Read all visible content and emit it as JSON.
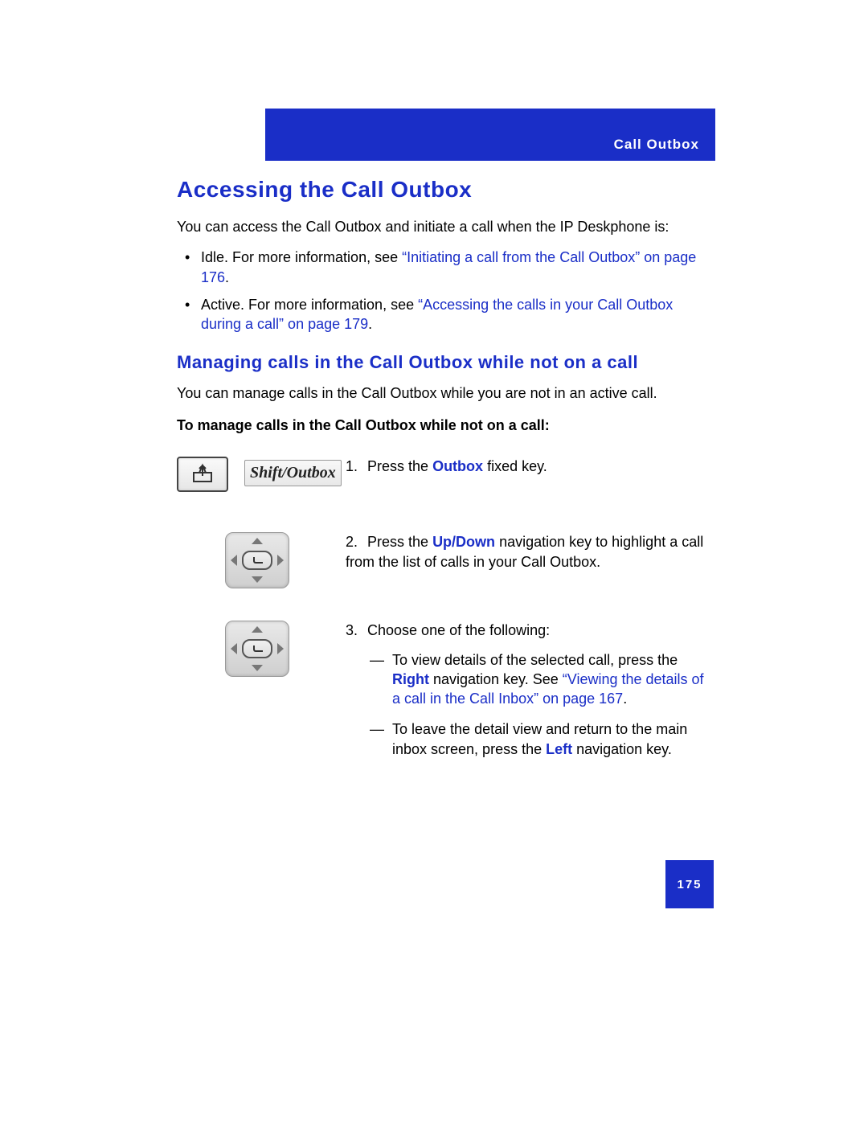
{
  "header": {
    "section": "Call Outbox"
  },
  "h1": "Accessing the Call Outbox",
  "intro": "You can access the Call Outbox and initiate a call when the IP Deskphone is:",
  "bullets": {
    "b1_pre": "Idle. For more information, see ",
    "b1_link": "“Initiating a call from the Call Outbox” on page 176",
    "b1_post": ".",
    "b2_pre": "Active. For more information, see ",
    "b2_link": "“Accessing the calls in your Call Outbox during a call” on page 179",
    "b2_post": "."
  },
  "h2": "Managing calls in the Call Outbox while not on a call",
  "para2": "You can manage calls in the Call Outbox while you are not in an active call.",
  "boldline": "To manage calls in the Call Outbox while not on a call:",
  "shift_label": "Shift/Outbox",
  "steps": {
    "s1_num": "1.",
    "s1_pre": "Press the ",
    "s1_key": "Outbox",
    "s1_post": " fixed key.",
    "s2_num": "2.",
    "s2_pre": "Press the ",
    "s2_key": "Up/Down",
    "s2_post": " navigation key to highlight a call from the list of calls in your Call Outbox.",
    "s3_num": "3.",
    "s3_text": "Choose one of the following:",
    "s3a_pre": "To view details of the selected call, press the ",
    "s3a_key": "Right",
    "s3a_mid": " navigation key. See ",
    "s3a_link": "“Viewing the details of a call in the Call Inbox” on page 167",
    "s3a_post": ".",
    "s3b_pre": "To leave the detail view and return to the main inbox screen, press the ",
    "s3b_key": "Left",
    "s3b_post": " navigation key."
  },
  "page_number": "175"
}
